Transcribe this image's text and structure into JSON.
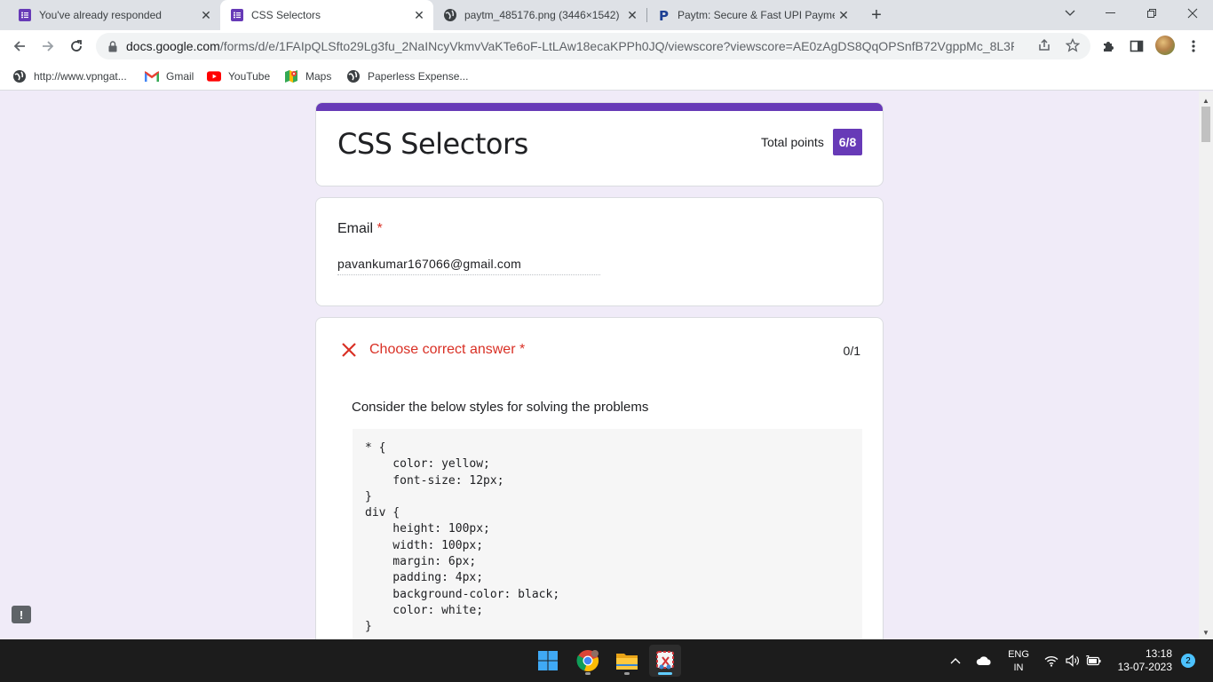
{
  "browser": {
    "tabs": [
      {
        "label": "You've already responded",
        "icon": "google-forms-icon",
        "active": false
      },
      {
        "label": "CSS Selectors",
        "icon": "google-forms-icon",
        "active": true
      },
      {
        "label": "paytm_485176.png (3446×1542)",
        "icon": "globe-icon",
        "active": false
      },
      {
        "label": "Paytm: Secure & Fast UPI Paymen",
        "icon": "paytm-icon",
        "active": false
      }
    ],
    "url_host": "docs.google.com",
    "url_path": "/forms/d/e/1FAIpQLSfto29Lg3fu_2NaINcyVkmvVaKTe6oF-LtLAw18ecaKPPh0JQ/viewscore?viewscore=AE0zAgDS8QqOPSnfB72VgppMc_8L3RcZk...",
    "bookmarks": [
      {
        "label": "http://www.vpngat...",
        "icon": "globe-icon"
      },
      {
        "label": "Gmail",
        "icon": "gmail-icon"
      },
      {
        "label": "YouTube",
        "icon": "youtube-icon"
      },
      {
        "label": "Maps",
        "icon": "maps-icon"
      },
      {
        "label": "Paperless Expense...",
        "icon": "globe-icon"
      }
    ]
  },
  "form": {
    "title": "CSS Selectors",
    "total_points_label": "Total points",
    "total_points_value": "6/8",
    "email": {
      "label": "Email",
      "required_mark": "*",
      "value": "pavankumar167066@gmail.com"
    },
    "question": {
      "title": "Choose correct answer",
      "required_mark": "*",
      "points": "0/1",
      "status": "incorrect",
      "description": "Consider the below styles for solving the problems",
      "code": "* {\n    color: yellow;\n    font-size: 12px;\n}\ndiv {\n    height: 100px;\n    width: 100px;\n    margin: 6px;\n    padding: 4px;\n    background-color: black;\n    color: white;\n}"
    }
  },
  "colors": {
    "form_accent": "#673ab7",
    "incorrect": "#d93025",
    "page_background": "#f0ebf8"
  },
  "taskbar": {
    "apps": [
      "windows-start-icon",
      "chrome-icon",
      "file-explorer-icon",
      "snipping-tool-icon"
    ],
    "language_line1": "ENG",
    "language_line2": "IN",
    "time": "13:18",
    "date": "13-07-2023",
    "notifications": "2"
  }
}
